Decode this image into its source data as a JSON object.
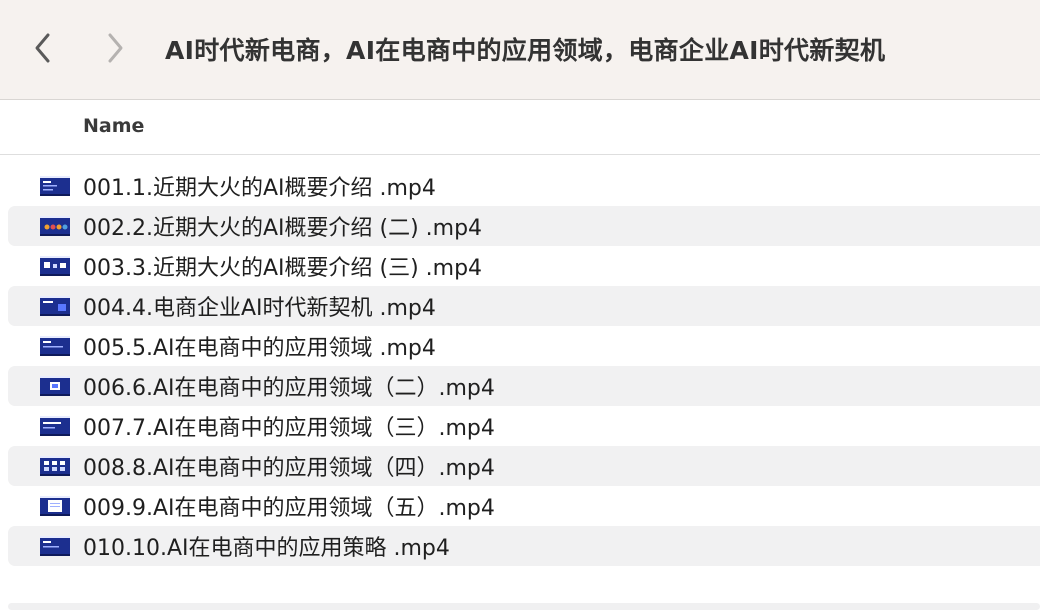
{
  "toolbar": {
    "back_icon": "chevron-left-icon",
    "forward_icon": "chevron-right-icon",
    "title": "AI时代新电商，AI在电商中的应用领域，电商企业AI时代新契机"
  },
  "columns": {
    "name_label": "Name"
  },
  "files": [
    {
      "name": "001.1.近期大火的AI概要介绍 .mp4",
      "thumb": "video-thumbnail-icon"
    },
    {
      "name": "002.2.近期大火的AI概要介绍 (二) .mp4",
      "thumb": "video-thumbnail-icon"
    },
    {
      "name": "003.3.近期大火的AI概要介绍 (三) .mp4",
      "thumb": "video-thumbnail-icon"
    },
    {
      "name": "004.4.电商企业AI时代新契机 .mp4",
      "thumb": "video-thumbnail-icon"
    },
    {
      "name": "005.5.AI在电商中的应用领域 .mp4",
      "thumb": "video-thumbnail-icon"
    },
    {
      "name": "006.6.AI在电商中的应用领域（二）.mp4",
      "thumb": "video-thumbnail-icon"
    },
    {
      "name": "007.7.AI在电商中的应用领域（三）.mp4",
      "thumb": "video-thumbnail-icon"
    },
    {
      "name": "008.8.AI在电商中的应用领域（四）.mp4",
      "thumb": "video-thumbnail-icon"
    },
    {
      "name": "009.9.AI在电商中的应用领域（五）.mp4",
      "thumb": "video-thumbnail-icon"
    },
    {
      "name": "010.10.AI在电商中的应用策略 .mp4",
      "thumb": "video-thumbnail-icon"
    }
  ],
  "colors": {
    "toolbar_bg": "#f6f2ef",
    "row_alt_bg": "#f1f1f2",
    "thumb_blue": "#1c2f8f"
  }
}
